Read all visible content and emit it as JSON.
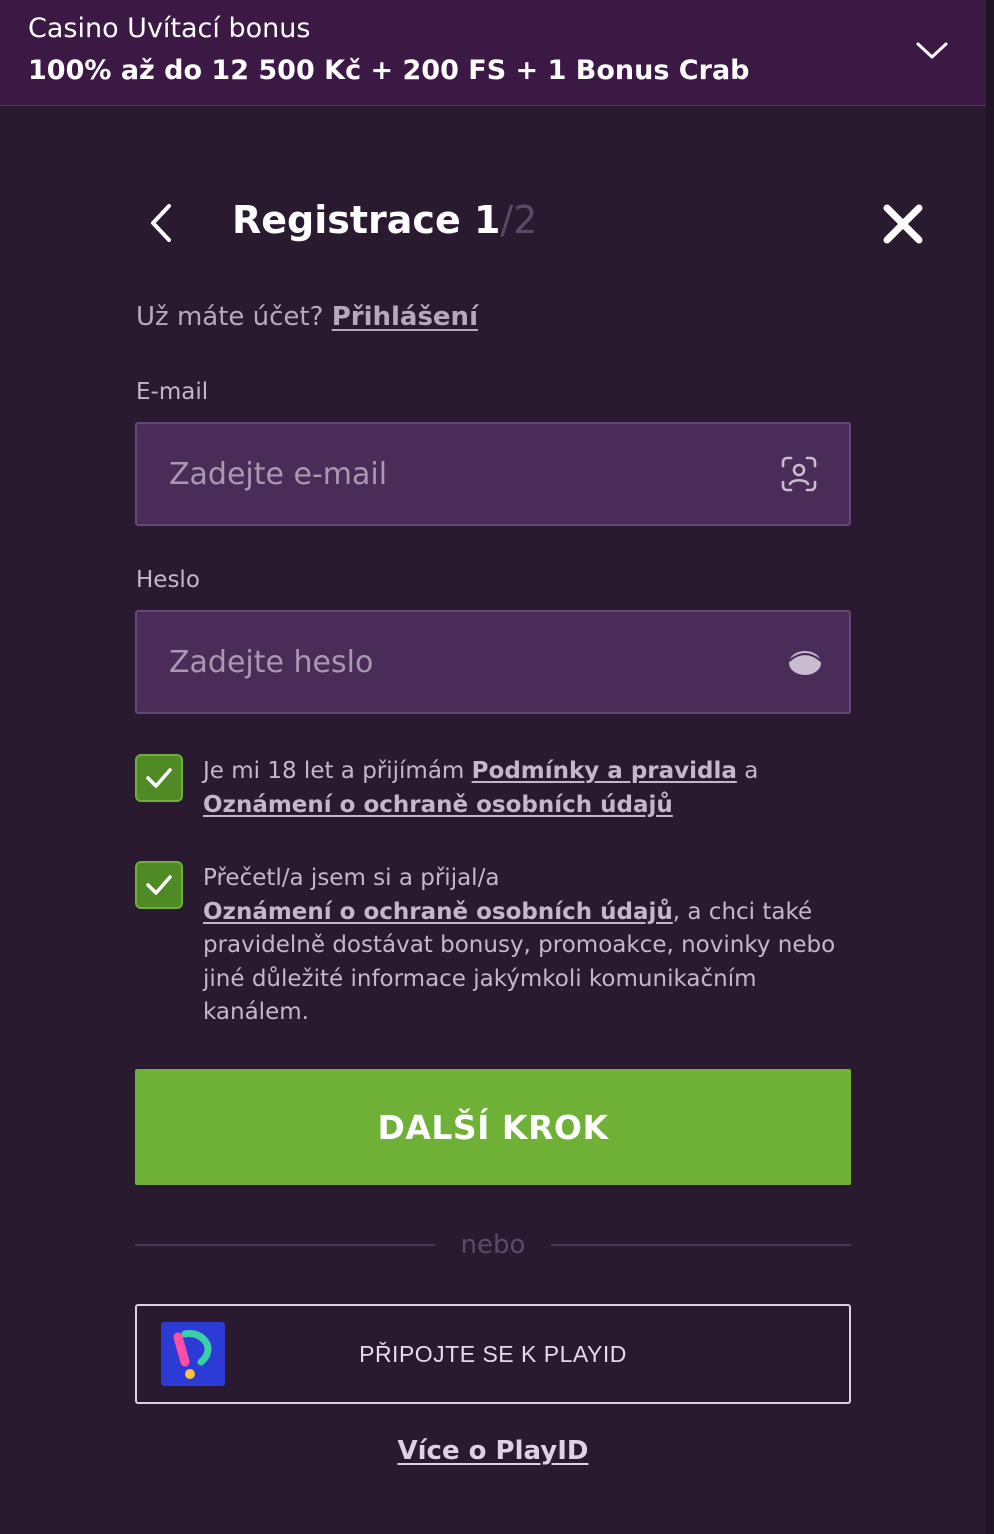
{
  "banner": {
    "title": "Casino Uvítací bonus",
    "offer": "100% až do 12 500 Kč + 200 FS + 1 Bonus Crab",
    "toggle_icon": "chevron-down-icon"
  },
  "header": {
    "title": "Registrace 1",
    "step_total": "/2",
    "back_icon": "chevron-left-icon",
    "close_icon": "close-icon"
  },
  "login": {
    "question": "Už máte účet? ",
    "link": "Přihlášení"
  },
  "email": {
    "label": "E-mail",
    "placeholder": "Zadejte e-mail",
    "value": "",
    "icon": "user-scan-icon"
  },
  "password": {
    "label": "Heslo",
    "placeholder": "Zadejte heslo",
    "value": "",
    "icon": "eye-icon"
  },
  "consents": [
    {
      "checked": true,
      "text_before": "Je mi 18 let a přijímám ",
      "link1": "Podmínky a pravidla",
      "text_middle": " a ",
      "link2": "Oznámení o ochraně osobních údajů"
    },
    {
      "checked": true,
      "text_before": "Přečetl/a jsem si a přijal/a ",
      "link": "Oznámení o ochraně osobních údajů",
      "text_after": ", a chci také pravidelně dostávat bonusy, promoakce, novinky nebo jiné důležité informace jakýmkoli komunikačním kanálem."
    }
  ],
  "next_button": "DALŠÍ KROK",
  "divider": "nebo",
  "playid": {
    "button_label": "PŘIPOJTE SE K PLAYID",
    "logo_icon": "playid-logo-icon",
    "more_link": "Více o PlayID"
  },
  "colors": {
    "background": "#2a1a30",
    "banner": "#3c1845",
    "input_bg": "#4a2c58",
    "accent_green": "#6fb136",
    "checkbox_green": "#4f8a24",
    "playid_blue": "#2c3bd6"
  }
}
